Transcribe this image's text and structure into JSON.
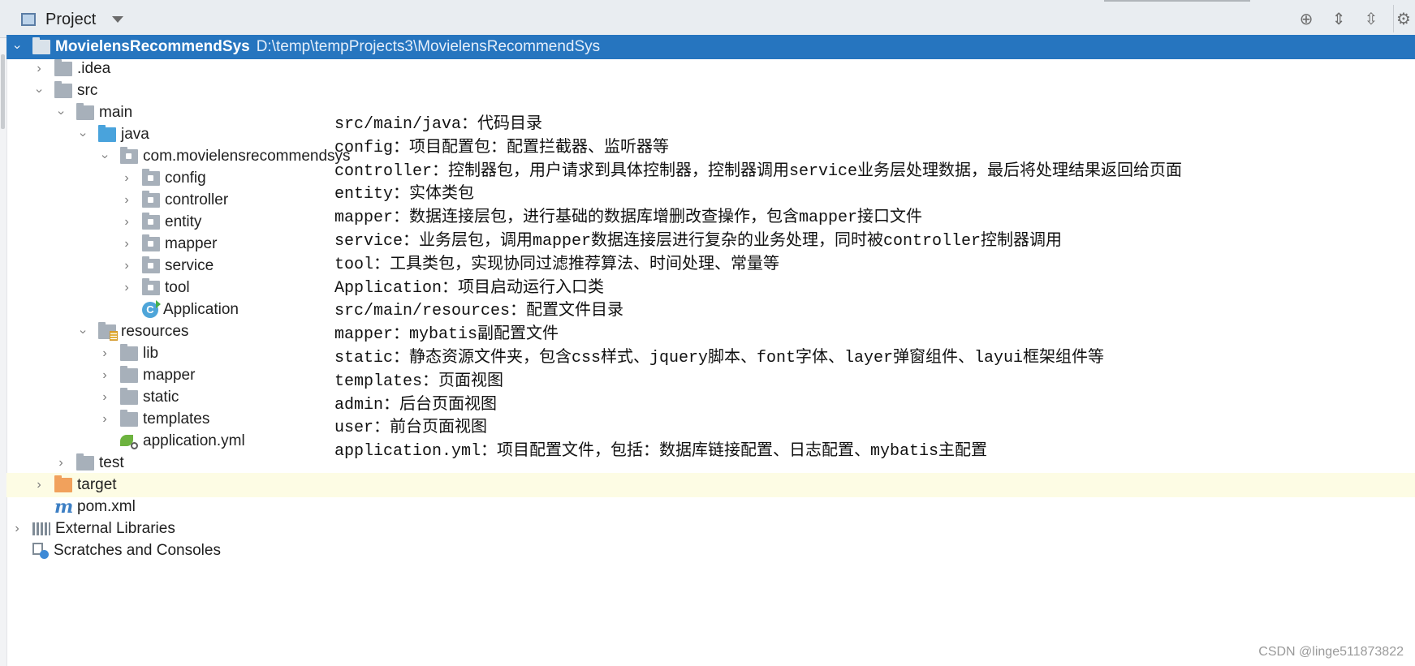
{
  "header": {
    "title": "Project",
    "tools": [
      "locate-icon",
      "expand-all-icon",
      "collapse-all-icon",
      "gear-icon"
    ]
  },
  "tree": [
    {
      "label": "MovielensRecommendSys",
      "path": "D:\\temp\\tempProjects3\\MovielensRecommendSys",
      "icon": "module-folder-icon",
      "depth": 0,
      "expanded": true,
      "selected": true
    },
    {
      "label": ".idea",
      "icon": "folder-icon",
      "depth": 1,
      "expanded": false
    },
    {
      "label": "src",
      "icon": "folder-icon",
      "depth": 1,
      "expanded": true
    },
    {
      "label": "main",
      "icon": "folder-icon",
      "depth": 2,
      "expanded": true
    },
    {
      "label": "java",
      "icon": "source-folder-icon",
      "depth": 3,
      "expanded": true
    },
    {
      "label": "com.movielensrecommendsys",
      "icon": "package-icon",
      "depth": 4,
      "expanded": true
    },
    {
      "label": "config",
      "icon": "package-icon",
      "depth": 5,
      "expanded": false
    },
    {
      "label": "controller",
      "icon": "package-icon",
      "depth": 5,
      "expanded": false
    },
    {
      "label": "entity",
      "icon": "package-icon",
      "depth": 5,
      "expanded": false
    },
    {
      "label": "mapper",
      "icon": "package-icon",
      "depth": 5,
      "expanded": false
    },
    {
      "label": "service",
      "icon": "package-icon",
      "depth": 5,
      "expanded": false
    },
    {
      "label": "tool",
      "icon": "package-icon",
      "depth": 5,
      "expanded": false
    },
    {
      "label": "Application",
      "icon": "spring-class-icon",
      "depth": 5,
      "leaf": true
    },
    {
      "label": "resources",
      "icon": "resources-folder-icon",
      "depth": 3,
      "expanded": true
    },
    {
      "label": "lib",
      "icon": "folder-icon",
      "depth": 4,
      "expanded": false
    },
    {
      "label": "mapper",
      "icon": "folder-icon",
      "depth": 4,
      "expanded": false
    },
    {
      "label": "static",
      "icon": "folder-icon",
      "depth": 4,
      "expanded": false
    },
    {
      "label": "templates",
      "icon": "folder-icon",
      "depth": 4,
      "expanded": false
    },
    {
      "label": "application.yml",
      "icon": "yml-file-icon",
      "depth": 4,
      "leaf": true
    },
    {
      "label": "test",
      "icon": "folder-icon",
      "depth": 2,
      "expanded": false
    },
    {
      "label": "target",
      "icon": "excluded-folder-icon",
      "depth": 1,
      "expanded": false,
      "highlight": true
    },
    {
      "label": "pom.xml",
      "icon": "maven-icon",
      "depth": 1,
      "leaf": true
    },
    {
      "label": "External Libraries",
      "icon": "libraries-icon",
      "depth": 0,
      "expanded": false
    },
    {
      "label": "Scratches and Consoles",
      "icon": "scratches-icon",
      "depth": 0,
      "leaf": true
    }
  ],
  "notes": [
    "src/main/java：代码目录",
    "config：项目配置包：配置拦截器、监听器等",
    "controller：控制器包，用户请求到具体控制器，控制器调用service业务层处理数据，最后将处理结果返回给页面",
    "entity：实体类包",
    "mapper：数据连接层包，进行基础的数据库增删改查操作，包含mapper接口文件",
    "service：业务层包，调用mapper数据连接层进行复杂的业务处理，同时被controller控制器调用",
    "tool：工具类包，实现协同过滤推荐算法、时间处理、常量等",
    "Application：项目启动运行入口类",
    "src/main/resources：配置文件目录",
    "mapper：mybatis副配置文件",
    "static：静态资源文件夹，包含css样式、jquery脚本、font字体、layer弹窗组件、layui框架组件等",
    "templates：页面视图",
    "admin：后台页面视图",
    "user：前台页面视图",
    "application.yml：项目配置文件，包括：数据库链接配置、日志配置、mybatis主配置"
  ],
  "watermark": "CSDN @linge511873822"
}
